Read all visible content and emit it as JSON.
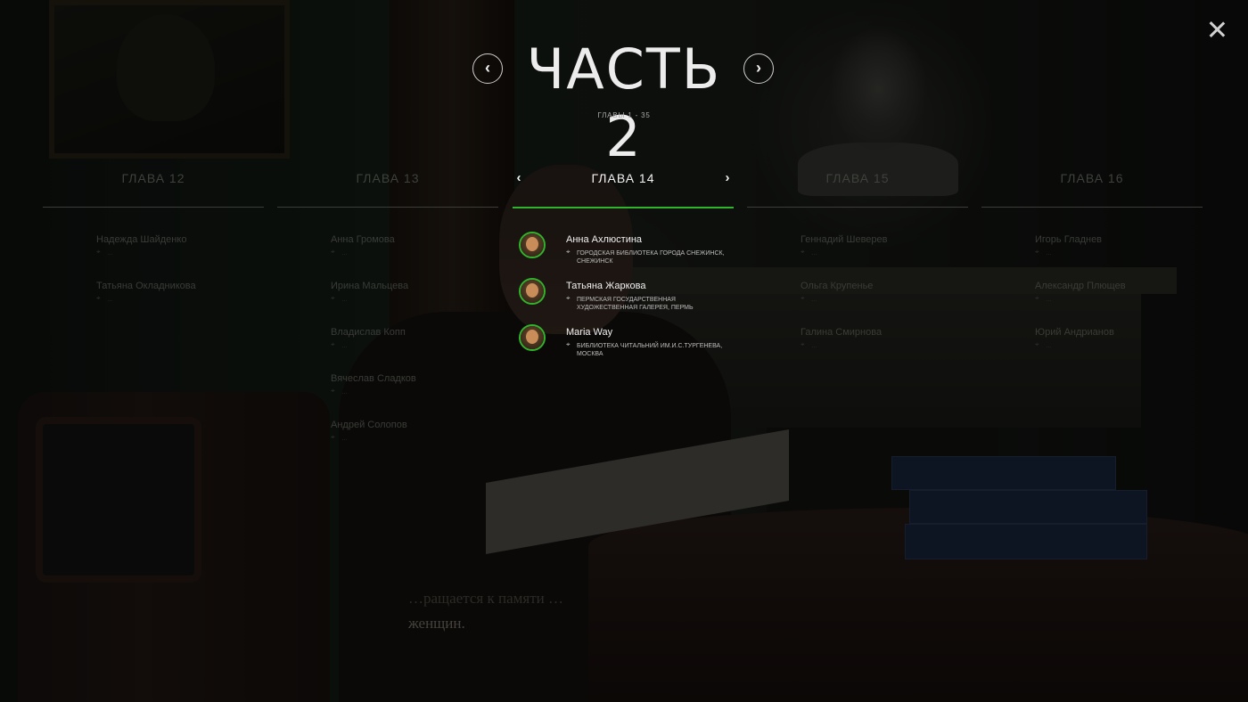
{
  "part": {
    "title": "ЧАСТЬ 2",
    "subtitle": "ГЛАВЫ 1 - 35",
    "prev_icon": "‹",
    "next_icon": "›"
  },
  "close_icon": "close-icon",
  "background_text": {
    "line1": "…ращается к памяти …",
    "line2": "женщин."
  },
  "colors": {
    "accent": "#31b32b",
    "text_active": "#f2f2f2",
    "text_dim": "#3f423c"
  },
  "chapters": [
    {
      "title": "ГЛАВА 12",
      "entries": [
        {
          "name": "Надежда Шайденко",
          "location": "…"
        },
        {
          "name": "Татьяна Окладникова",
          "location": "…"
        }
      ]
    },
    {
      "title": "ГЛАВА 13",
      "entries": [
        {
          "name": "Анна Громова",
          "location": "…"
        },
        {
          "name": "Ирина Мальцева",
          "location": "…"
        },
        {
          "name": "Владислав Копп",
          "location": "…"
        },
        {
          "name": "Вячеслав Сладков",
          "location": "…"
        },
        {
          "name": "Андрей Солопов",
          "location": "…"
        }
      ]
    },
    {
      "title": "ГЛАВА 14",
      "active": true,
      "entries": [
        {
          "name": "Анна Ахлюстина",
          "location": "ГОРОДСКАЯ БИБЛИОТЕКА ГОРОДА СНЕЖИНСК, СНЕЖИНСК"
        },
        {
          "name": "Татьяна Жаркова",
          "location": "ПЕРМСКАЯ ГОСУДАРСТВЕННАЯ ХУДОЖЕСТВЕННАЯ ГАЛЕРЕЯ, ПЕРМЬ"
        },
        {
          "name": "Maria Way",
          "location": "БИБЛИОТЕКА ЧИТАЛЬНИЙ ИМ.И.С.ТУРГЕНЕВА, МОСКВА"
        }
      ]
    },
    {
      "title": "ГЛАВА 15",
      "entries": [
        {
          "name": "Геннадий Шеверев",
          "location": "…"
        },
        {
          "name": "Ольга Крупенье",
          "location": "…"
        },
        {
          "name": "Галина Смирнова",
          "location": "…"
        }
      ]
    },
    {
      "title": "ГЛАВА 16",
      "entries": [
        {
          "name": "Игорь Гладнев",
          "location": "…"
        },
        {
          "name": "Александр Плющев",
          "location": "…"
        },
        {
          "name": "Юрий Андрианов",
          "location": "…"
        }
      ]
    }
  ]
}
